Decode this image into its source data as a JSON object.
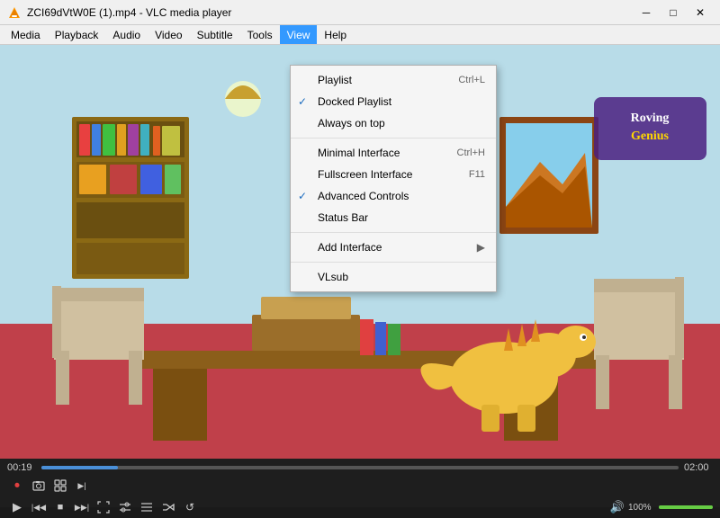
{
  "titleBar": {
    "title": "ZCI69dVtW0E (1).mp4 - VLC media player",
    "minBtn": "─",
    "maxBtn": "□",
    "closeBtn": "✕"
  },
  "menuBar": {
    "items": [
      {
        "label": "Media",
        "active": false
      },
      {
        "label": "Playback",
        "active": false
      },
      {
        "label": "Audio",
        "active": false
      },
      {
        "label": "Video",
        "active": false
      },
      {
        "label": "Subtitle",
        "active": false
      },
      {
        "label": "Tools",
        "active": false
      },
      {
        "label": "View",
        "active": true
      },
      {
        "label": "Help",
        "active": false
      }
    ]
  },
  "viewMenu": {
    "items": [
      {
        "label": "Playlist",
        "shortcut": "Ctrl+L",
        "check": "",
        "hasSep": false
      },
      {
        "label": "Docked Playlist",
        "shortcut": "",
        "check": "✓",
        "checkBlue": true,
        "hasSep": false
      },
      {
        "label": "Always on top",
        "shortcut": "",
        "check": "",
        "hasSep": false
      },
      {
        "label": "",
        "isSep": true
      },
      {
        "label": "Minimal Interface",
        "shortcut": "Ctrl+H",
        "check": "",
        "hasSep": false
      },
      {
        "label": "Fullscreen Interface",
        "shortcut": "F11",
        "check": "",
        "hasSep": false
      },
      {
        "label": "Advanced Controls",
        "shortcut": "",
        "check": "✓",
        "checkBlue": true,
        "hasSep": false
      },
      {
        "label": "Status Bar",
        "shortcut": "",
        "check": "",
        "hasSep": false
      },
      {
        "label": "",
        "isSep": true
      },
      {
        "label": "Add Interface",
        "shortcut": "",
        "check": "",
        "hasArrow": true,
        "hasSep": false
      },
      {
        "label": "",
        "isSep": true
      },
      {
        "label": "VLsub",
        "shortcut": "",
        "check": "",
        "hasSep": false
      }
    ]
  },
  "progressBar": {
    "currentTime": "00:19",
    "totalTime": "02:00",
    "fillPercent": 12
  },
  "controls": {
    "row1": [
      {
        "icon": "⏺",
        "name": "record-btn",
        "red": true
      },
      {
        "icon": "📷",
        "name": "snapshot-btn"
      },
      {
        "icon": "⊞",
        "name": "extended-btn"
      },
      {
        "icon": "▶|",
        "name": "frame-next-btn"
      }
    ],
    "row2": [
      {
        "icon": "▶",
        "name": "play-btn"
      },
      {
        "icon": "|◀◀",
        "name": "prev-btn"
      },
      {
        "icon": "■",
        "name": "stop-btn"
      },
      {
        "icon": "▶▶|",
        "name": "next-btn"
      },
      {
        "icon": "⛶",
        "name": "fullscreen-btn"
      },
      {
        "icon": "≡|",
        "name": "extended-settings-btn"
      },
      {
        "icon": "⇄",
        "name": "playlist-btn"
      },
      {
        "icon": "🔀",
        "name": "random-btn"
      },
      {
        "icon": "↺",
        "name": "loop-btn"
      }
    ],
    "volume": {
      "icon": "🔊",
      "label": "100%",
      "fillPercent": 100
    }
  }
}
